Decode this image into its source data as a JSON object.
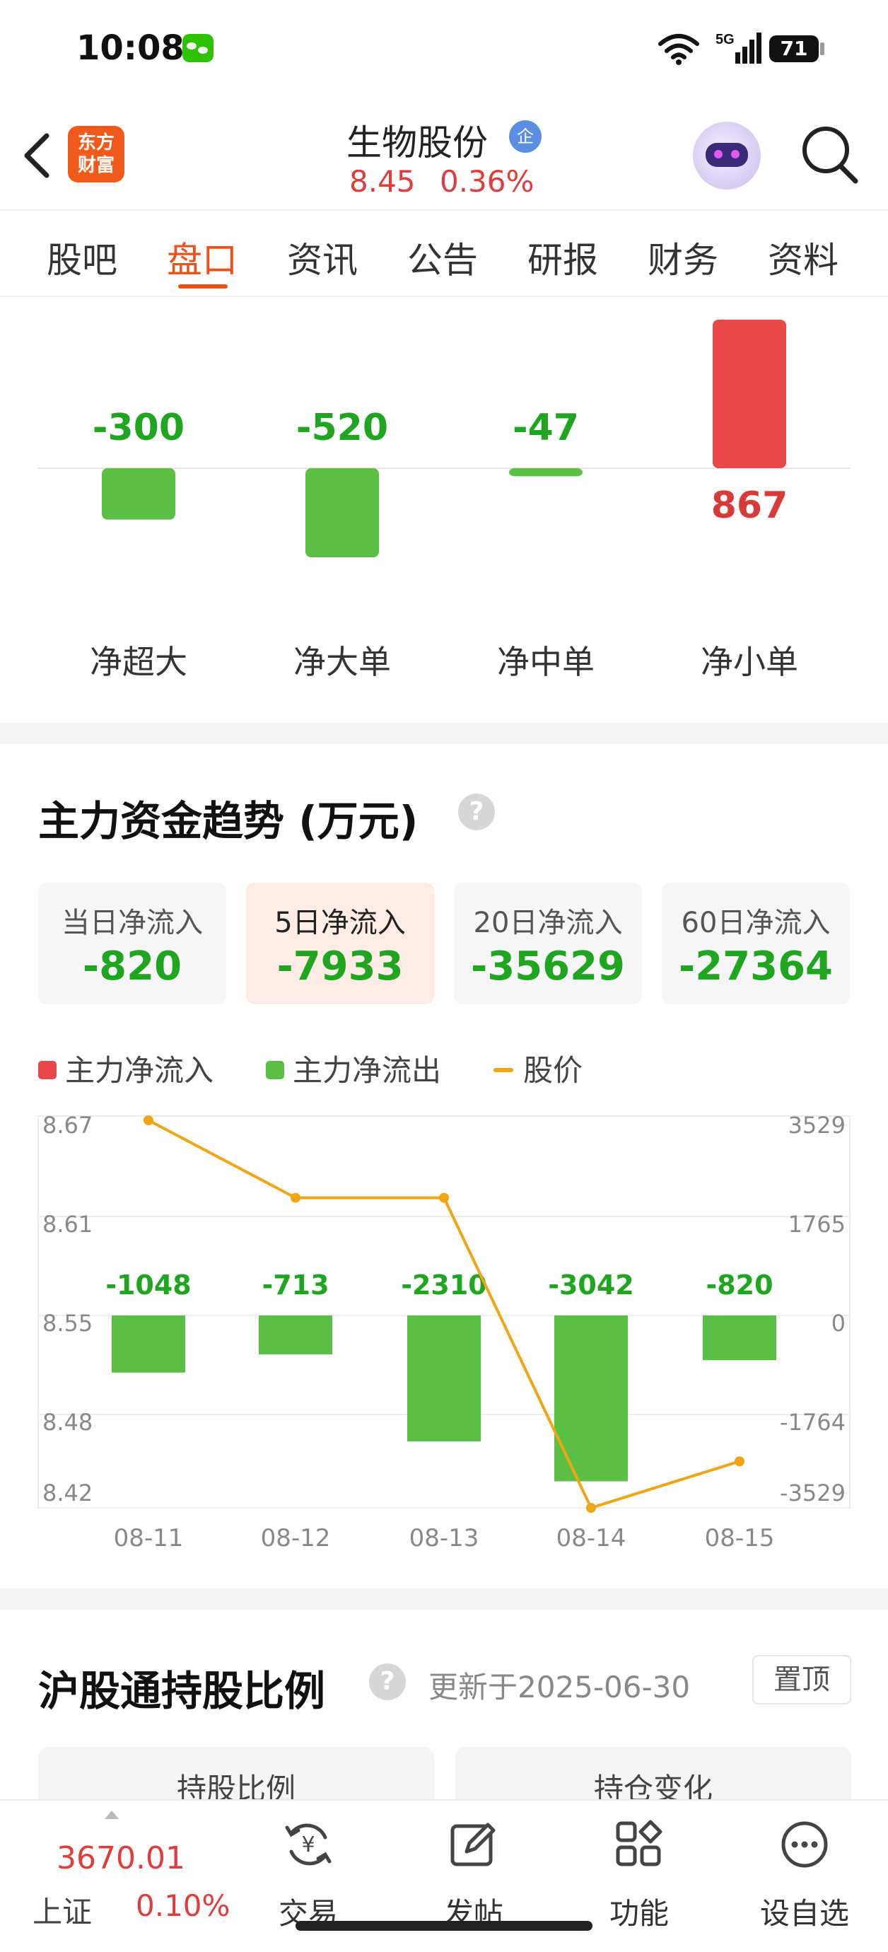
{
  "status_bar": {
    "time": "10:08",
    "network": "5G",
    "battery": "71"
  },
  "header": {
    "logo_text": "东方\n财富",
    "stock_name": "生物股份",
    "badge": "企",
    "price": "8.45",
    "change_pct": "0.36%"
  },
  "tabs": [
    "股吧",
    "盘口",
    "资讯",
    "公告",
    "研报",
    "财务",
    "资料"
  ],
  "active_tab": "盘口",
  "flow_chart": {
    "type": "bar",
    "categories": [
      "净超大",
      "净大单",
      "净中单",
      "净小单"
    ],
    "values": [
      -300,
      -520,
      -47,
      867
    ],
    "value_labels": [
      "-300",
      "-520",
      "-47",
      "867"
    ],
    "colors": {
      "positive": "#e84848",
      "negative": "#5cbf45"
    }
  },
  "trend": {
    "title": "主力资金趋势 (万元)",
    "cards": [
      {
        "label": "当日净流入",
        "value": "-820"
      },
      {
        "label": "5日净流入",
        "value": "-7933"
      },
      {
        "label": "20日净流入",
        "value": "-35629"
      },
      {
        "label": "60日净流入",
        "value": "-27364"
      }
    ],
    "active_card": 1,
    "legend": [
      {
        "label": "主力净流入",
        "color": "#e84848"
      },
      {
        "label": "主力净流出",
        "color": "#5cbf45"
      },
      {
        "label": "股价",
        "color": "#f0a514"
      }
    ]
  },
  "chart_data": {
    "type": "bar",
    "categories": [
      "08-11",
      "08-12",
      "08-13",
      "08-14",
      "08-15"
    ],
    "series": [
      {
        "name": "主力净流出",
        "values": [
          -1048,
          -713,
          -2310,
          -3042,
          -820
        ]
      },
      {
        "name": "股价",
        "values": [
          8.67,
          8.62,
          8.62,
          8.42,
          8.45
        ]
      }
    ],
    "value_labels": [
      "-1048",
      "-713",
      "-2310",
      "-3042",
      "-820"
    ],
    "y_left_ticks": [
      "8.67",
      "8.61",
      "8.55",
      "8.48",
      "8.42"
    ],
    "y_left_range": [
      8.42,
      8.67
    ],
    "y_right_ticks": [
      "3529",
      "1765",
      "0",
      "-1764",
      "-3529"
    ],
    "y_right_range": [
      -3529,
      3529
    ],
    "grid": true,
    "legend_position": "top-left"
  },
  "hk_connect": {
    "title": "沪股通持股比例",
    "updated": "更新于2025-06-30",
    "pin_label": "置顶",
    "tabs": [
      "持股比例",
      "持仓变化"
    ]
  },
  "bottom_bar": {
    "index_value": "3670.01",
    "index_name": "上证",
    "index_pct": "0.10%",
    "nav": [
      {
        "label": "交易",
        "icon": "trade-icon"
      },
      {
        "label": "发帖",
        "icon": "post-icon"
      },
      {
        "label": "功能",
        "icon": "apps-icon"
      },
      {
        "label": "设自选",
        "icon": "more-icon"
      }
    ]
  }
}
